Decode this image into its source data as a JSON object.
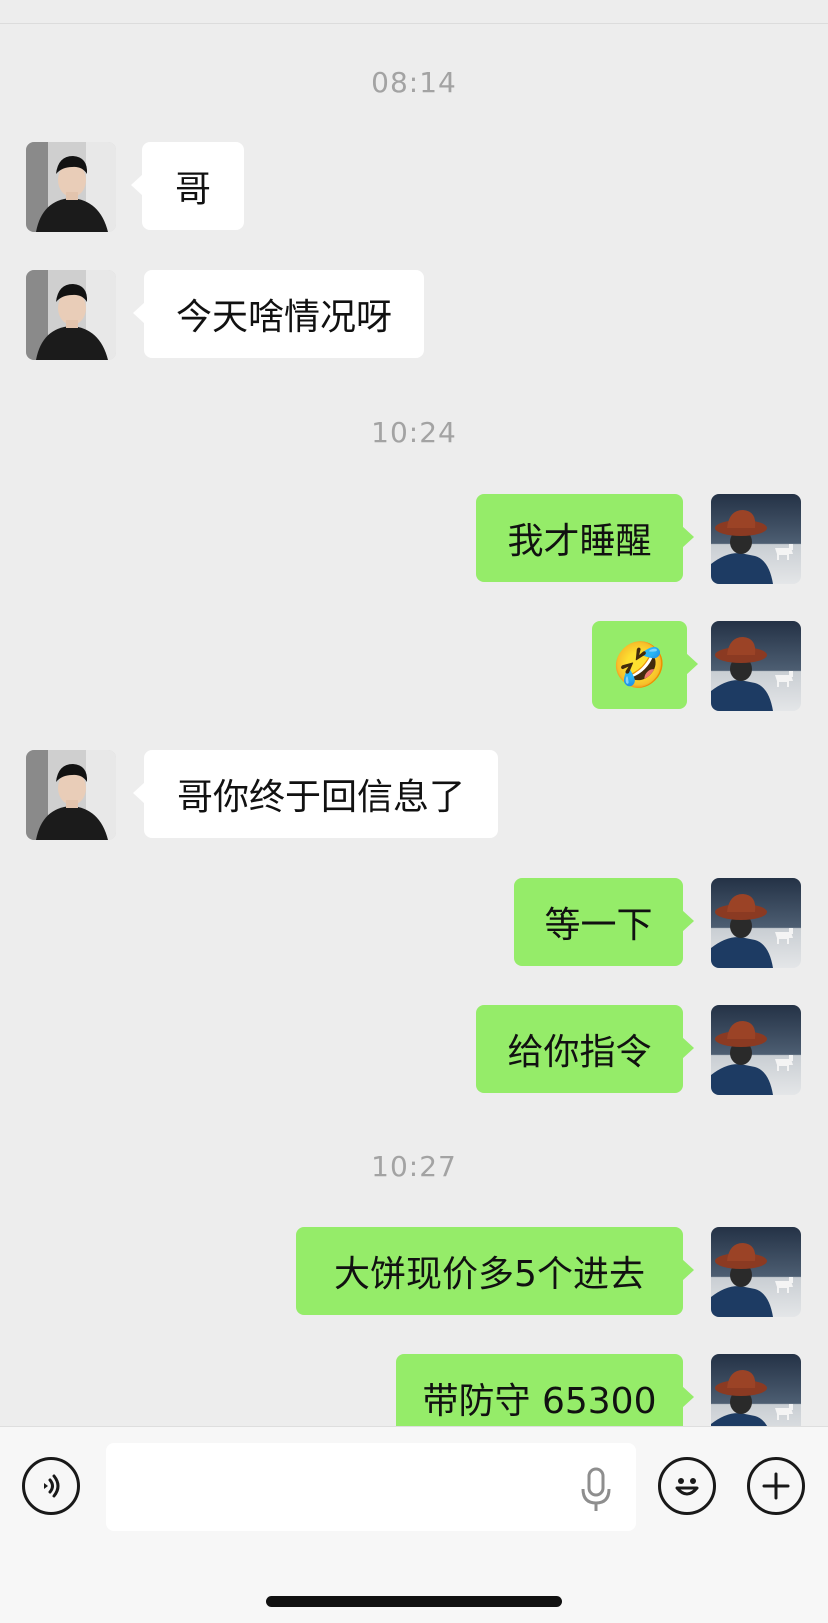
{
  "colors": {
    "background": "#ededed",
    "incoming_bubble": "#ffffff",
    "outgoing_bubble": "#95ec69",
    "timestamp_text": "#a3a3a3"
  },
  "messages": [
    {
      "type": "time",
      "text": "08:14"
    },
    {
      "type": "msg",
      "dir": "in",
      "text": "哥"
    },
    {
      "type": "msg",
      "dir": "in",
      "text": "今天啥情况呀"
    },
    {
      "type": "time",
      "text": "10:24"
    },
    {
      "type": "msg",
      "dir": "out",
      "text": "我才睡醒"
    },
    {
      "type": "msg",
      "dir": "out",
      "text": "🤣",
      "emoji": "rolling-laughing-emoji"
    },
    {
      "type": "msg",
      "dir": "in",
      "text": "哥你终于回信息了"
    },
    {
      "type": "msg",
      "dir": "out",
      "text": "等一下"
    },
    {
      "type": "msg",
      "dir": "out",
      "text": "给你指令"
    },
    {
      "type": "time",
      "text": "10:27"
    },
    {
      "type": "msg",
      "dir": "out",
      "text": "大饼现价多5个进去"
    },
    {
      "type": "msg",
      "dir": "out",
      "text": "带防守 65300"
    }
  ],
  "avatars": {
    "incoming": "young-man-portrait",
    "outgoing": "cowboy-hat-figure-with-white-horse"
  },
  "input_bar": {
    "text_value": "",
    "left_icon": "voice-icon",
    "inner_icon": "microphone-icon",
    "right_icons": [
      "emoji-icon",
      "plus-icon"
    ]
  }
}
